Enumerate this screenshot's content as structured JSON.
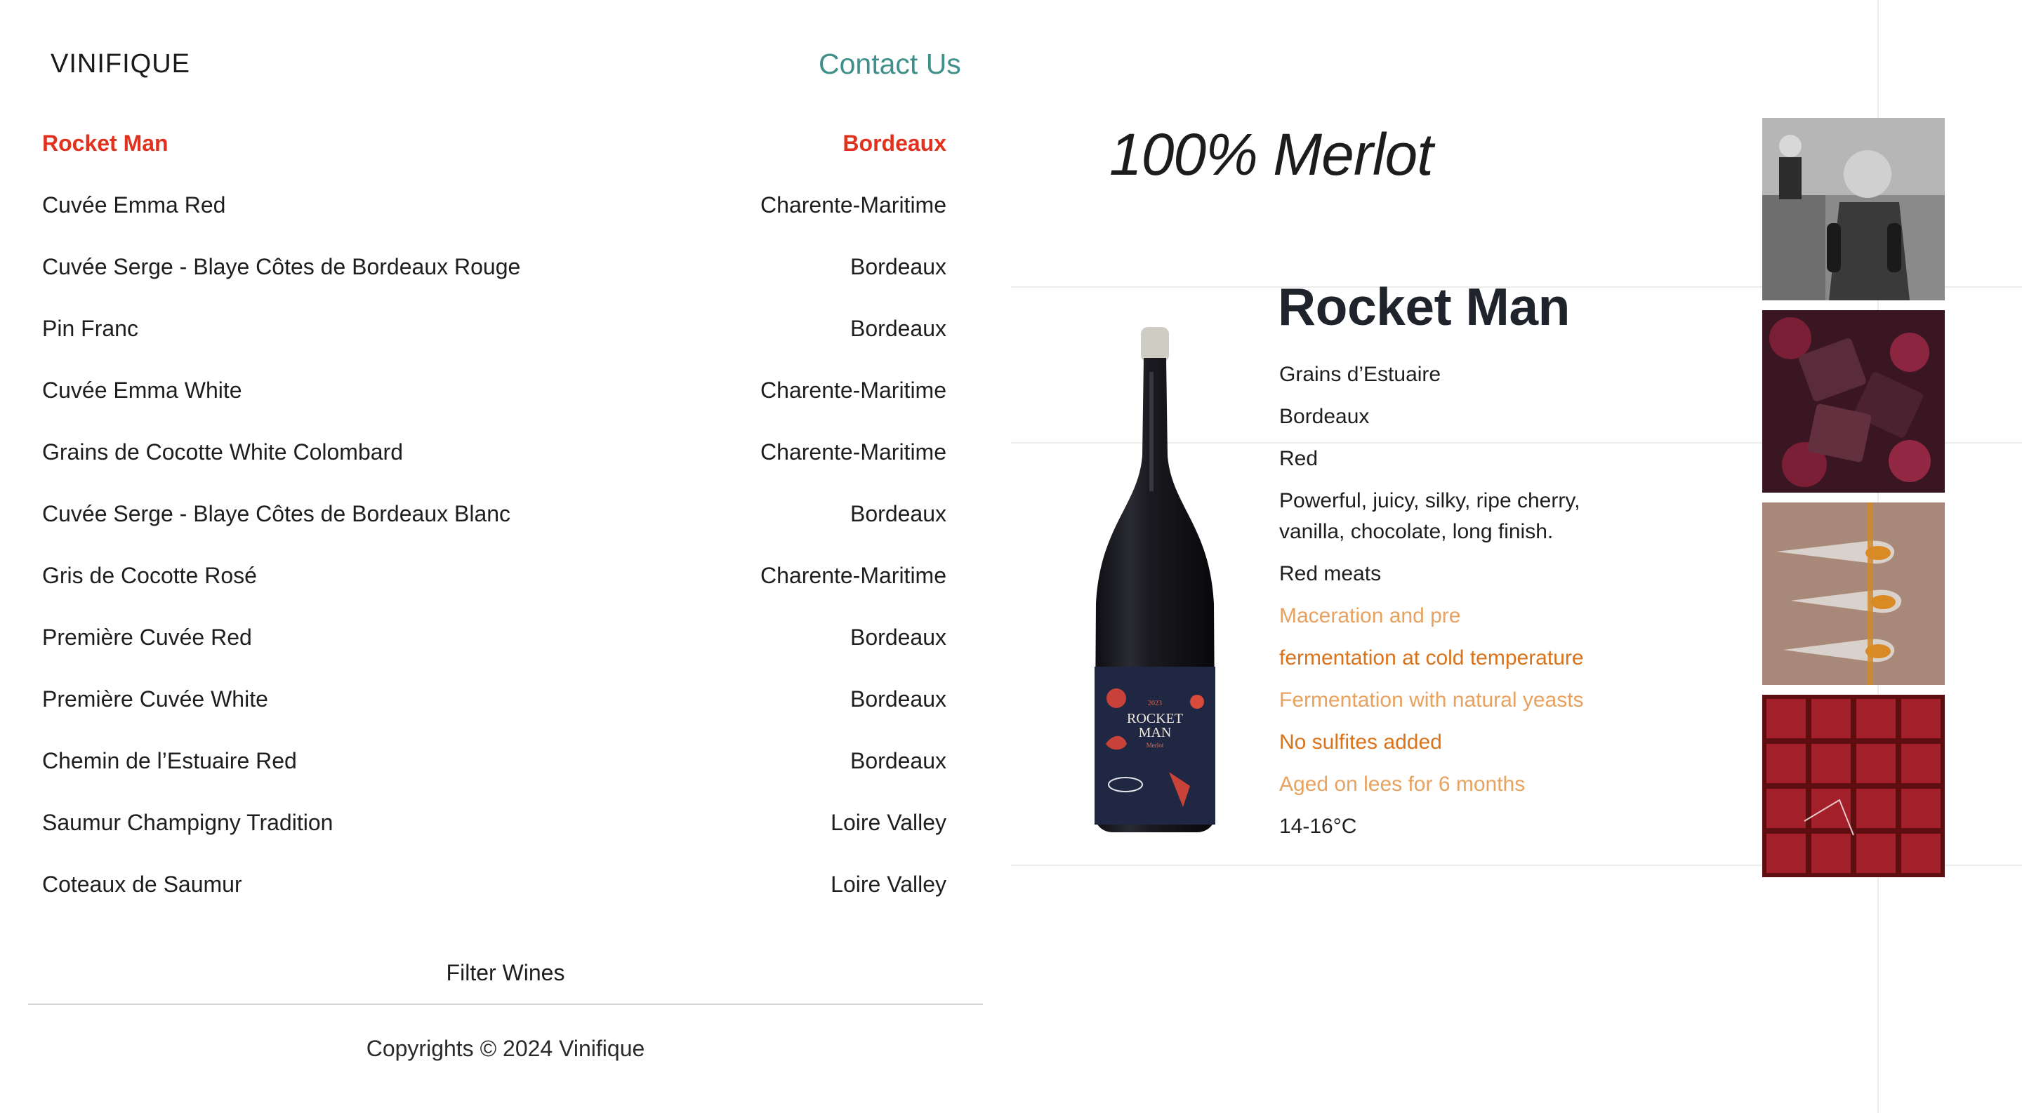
{
  "header": {
    "brand": "VINIFIQUE",
    "contact": "Contact Us"
  },
  "wines": [
    {
      "name": "Rocket Man",
      "region": "Bordeaux",
      "active": true
    },
    {
      "name": "Cuvée Emma Red",
      "region": "Charente-Maritime"
    },
    {
      "name": "Cuvée Serge - Blaye Côtes de Bordeaux Rouge",
      "region": "Bordeaux"
    },
    {
      "name": "Pin Franc",
      "region": "Bordeaux"
    },
    {
      "name": "Cuvée Emma White",
      "region": "Charente-Maritime"
    },
    {
      "name": "Grains de Cocotte White Colombard",
      "region": "Charente-Maritime"
    },
    {
      "name": "Cuvée Serge - Blaye Côtes de Bordeaux Blanc",
      "region": "Bordeaux"
    },
    {
      "name": "Gris de Cocotte Rosé",
      "region": "Charente-Maritime"
    },
    {
      "name": "Première Cuvée Red",
      "region": "Bordeaux"
    },
    {
      "name": "Première Cuvée White",
      "region": "Bordeaux"
    },
    {
      "name": "Chemin de l’Estuaire Red",
      "region": "Bordeaux"
    },
    {
      "name": "Saumur Champigny Tradition",
      "region": "Loire Valley"
    },
    {
      "name": "Coteaux de Saumur",
      "region": "Loire Valley"
    }
  ],
  "filter_label": "Filter Wines",
  "footer": {
    "copyright": "Copyrights © 2024 Vinifique"
  },
  "detail": {
    "grape": "100% Merlot",
    "name": "Rocket Man",
    "producer": "Grains d’Estuaire",
    "region": "Bordeaux",
    "color": "Red",
    "tasting": "Powerful, juicy, silky, ripe cherry, vanilla, chocolate, long finish.",
    "pairing": "Red meats",
    "methods": [
      "Maceration and pre",
      "fermentation at cold temperature",
      "Fermentation with natural yeasts",
      "No sulfites added",
      "Aged on lees for 6 months"
    ],
    "serving_temp": "14-16°C",
    "label": {
      "vintage": "2023",
      "line1": "ROCKET",
      "line2": "MAN",
      "grape": "Merlot"
    }
  },
  "colors": {
    "accent_red": "#e0321e",
    "contact_teal": "#3f8f8b",
    "method_light": "#e8a25f",
    "method_dark": "#d9731c"
  },
  "photos": [
    {
      "icon": "vintage-boy-with-wine-photo"
    },
    {
      "icon": "chocolate-and-berries-photo"
    },
    {
      "icon": "honey-spoons-photo"
    },
    {
      "icon": "red-tiles-photo"
    }
  ]
}
